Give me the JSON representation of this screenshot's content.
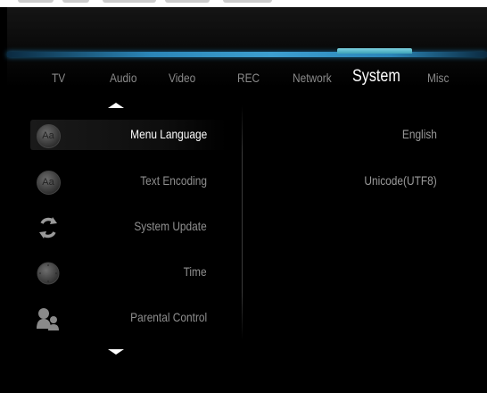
{
  "tabs": [
    {
      "id": "tv",
      "label": "TV"
    },
    {
      "id": "audio",
      "label": "Audio"
    },
    {
      "id": "video",
      "label": "Video"
    },
    {
      "id": "rec",
      "label": "REC"
    },
    {
      "id": "network",
      "label": "Network"
    },
    {
      "id": "system",
      "label": "System"
    },
    {
      "id": "misc",
      "label": "Misc"
    }
  ],
  "active_tab": "System",
  "menu": [
    {
      "label": "Menu Language",
      "value": "English",
      "icon": "language-icon",
      "selected": true
    },
    {
      "label": "Text Encoding",
      "value": "Unicode(UTF8)",
      "icon": "text-encoding-icon"
    },
    {
      "label": "System Update",
      "value": "",
      "icon": "refresh-icon"
    },
    {
      "label": "Time",
      "value": "",
      "icon": "clock-icon"
    },
    {
      "label": "Parental Control",
      "value": "",
      "icon": "parental-control-icon"
    }
  ],
  "icon_glyphs": {
    "language": "Aa",
    "text_encoding": "Aa"
  },
  "colors": {
    "background": "#000000",
    "tab_bar_accent": "#3d9fd0",
    "active_tab_highlight": "#7ed3e0",
    "selected_text": "#ffffff",
    "normal_text": "#8f8f8f"
  }
}
